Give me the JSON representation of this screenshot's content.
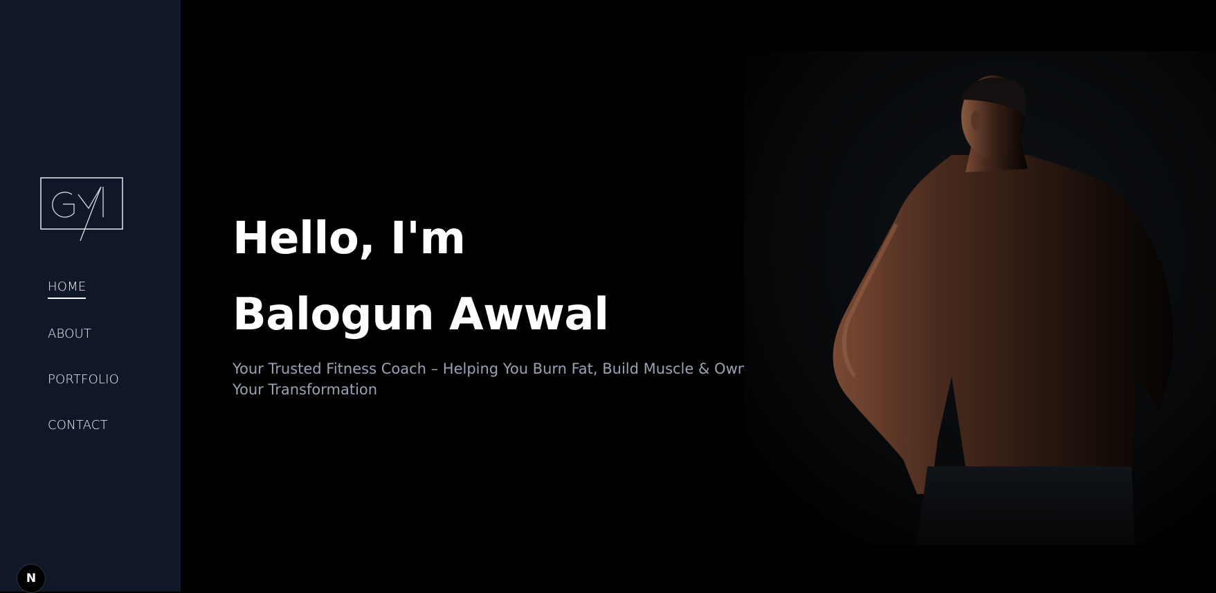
{
  "logo": {
    "letters": "GYA"
  },
  "nav": {
    "items": [
      {
        "label": "HOME",
        "active": true
      },
      {
        "label": "ABOUT",
        "active": false
      },
      {
        "label": "PORTFOLIO",
        "active": false
      },
      {
        "label": "CONTACT",
        "active": false
      }
    ]
  },
  "hero": {
    "greeting": "Hello, I'm",
    "name": "Balogun Awwal",
    "subtitle": "Your Trusted Fitness Coach – Helping You Burn Fat, Build Muscle & Own Your Transformation",
    "photo_icon": "athlete-photo"
  },
  "badge": {
    "label": "N",
    "icon": "nextjs-icon"
  },
  "colors": {
    "sidebar_bg": "#101727",
    "main_bg": "#000000",
    "heading": "#ffffff",
    "subtitle": "#9aa2b3"
  }
}
